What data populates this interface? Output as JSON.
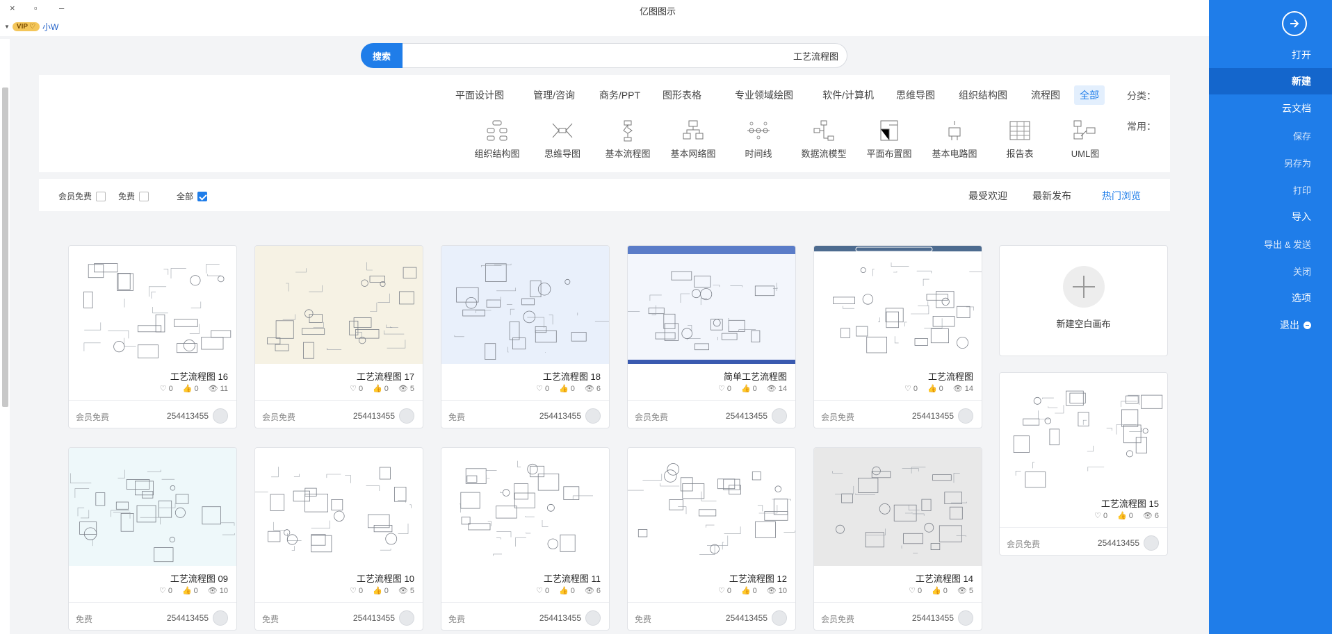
{
  "window": {
    "title": "亿图图示",
    "close": "×",
    "restore": "▫",
    "minimize": "–"
  },
  "user": {
    "name": "小W",
    "vip": "VIP"
  },
  "sidebar": {
    "items": [
      {
        "label": "打开"
      },
      {
        "label": "新建"
      },
      {
        "label": "云文档"
      },
      {
        "label": "保存"
      },
      {
        "label": "另存为"
      },
      {
        "label": "打印"
      },
      {
        "label": "导入"
      },
      {
        "label": "导出 & 发送"
      },
      {
        "label": "关闭"
      },
      {
        "label": "选项"
      },
      {
        "label": "退出"
      }
    ]
  },
  "search": {
    "button": "搜索",
    "value": "工艺流程图"
  },
  "categories": {
    "label": "分类：",
    "items": [
      "全部",
      "流程图",
      "组织结构图",
      "思维导图",
      "软件/计算机",
      "专业领域绘图",
      "图形表格",
      "商务/PPT",
      "管理/咨询",
      "平面设计图"
    ],
    "common_label": "常用：",
    "common": [
      "UML图",
      "报告表",
      "基本电路图",
      "平面布置图",
      "数据流模型",
      "时间线",
      "基本网络图",
      "基本流程图",
      "思维导图",
      "组织结构图"
    ]
  },
  "sort": {
    "items": [
      "热门浏览",
      "最新发布",
      "最受欢迎"
    ]
  },
  "filters": {
    "all": "全部",
    "free": "免费",
    "member": "会员免费"
  },
  "new_blank": {
    "label": "新建空白画布"
  },
  "cards": [
    {
      "name": "工艺流程图",
      "views": "14",
      "likes": "0",
      "favs": "0",
      "author": "254413455",
      "price": "会员免费"
    },
    {
      "name": "简单工艺流程图",
      "views": "14",
      "likes": "0",
      "favs": "0",
      "author": "254413455",
      "price": "会员免费"
    },
    {
      "name": "工艺流程图 18",
      "views": "6",
      "likes": "0",
      "favs": "0",
      "author": "254413455",
      "price": "免费"
    },
    {
      "name": "工艺流程图 17",
      "views": "5",
      "likes": "0",
      "favs": "0",
      "author": "254413455",
      "price": "会员免费"
    },
    {
      "name": "工艺流程图 16",
      "views": "11",
      "likes": "0",
      "favs": "0",
      "author": "254413455",
      "price": "会员免费"
    },
    {
      "name": "工艺流程图 15",
      "views": "6",
      "likes": "0",
      "favs": "0",
      "author": "254413455",
      "price": "会员免费"
    },
    {
      "name": "工艺流程图 14",
      "views": "5",
      "likes": "0",
      "favs": "0",
      "author": "254413455",
      "price": "会员免费"
    },
    {
      "name": "工艺流程图 12",
      "views": "10",
      "likes": "0",
      "favs": "0",
      "author": "254413455",
      "price": "免费"
    },
    {
      "name": "工艺流程图 11",
      "views": "6",
      "likes": "0",
      "favs": "0",
      "author": "254413455",
      "price": "免费"
    },
    {
      "name": "工艺流程图 10",
      "views": "5",
      "likes": "0",
      "favs": "0",
      "author": "254413455",
      "price": "免费"
    },
    {
      "name": "工艺流程图 09",
      "views": "10",
      "likes": "0",
      "favs": "0",
      "author": "254413455",
      "price": "免费"
    }
  ],
  "colors": {
    "accent": "#1f7de9",
    "sidebar": "#1f7de9",
    "sidebar_active": "#1466cc"
  }
}
